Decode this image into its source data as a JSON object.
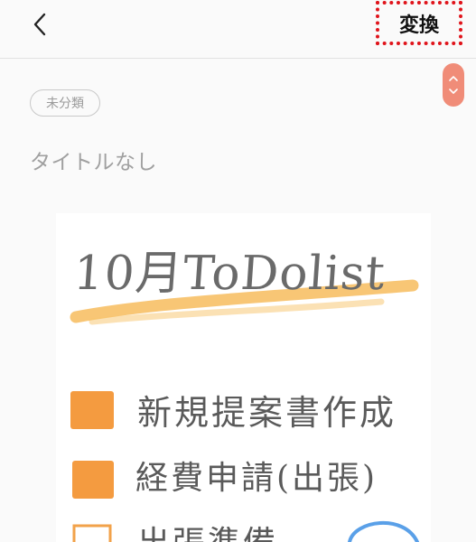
{
  "header": {
    "convert_label": "変換"
  },
  "note": {
    "category_tag": "未分類",
    "title": "タイトルなし"
  },
  "handwriting": {
    "heading": "10月ToDolist",
    "items": [
      "新規提案書作成",
      "経費申請(出張)",
      "出張準備"
    ]
  },
  "icons": {
    "back": "chevron-left-icon",
    "scroll_up": "chevron-up-icon",
    "scroll_down": "chevron-down-icon"
  },
  "colors": {
    "accent": "#f08c78",
    "highlight": "#f5b347",
    "checkbox": "#f28a1e",
    "marker_border": "#e0141b"
  }
}
